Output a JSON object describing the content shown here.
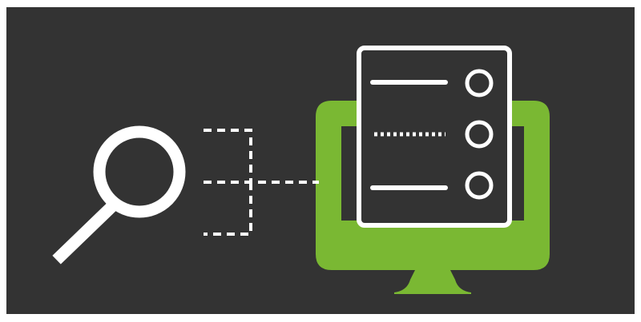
{
  "colors": {
    "page_background": "#ffffff",
    "panel_background": "#333333",
    "line_white": "#ffffff",
    "monitor_green": "#7ab833"
  },
  "icons": {
    "search": "magnifier-icon",
    "connector": "dashed-connector",
    "monitor": "desktop-monitor-icon",
    "document": "list-document-icon"
  },
  "document": {
    "rows": [
      {
        "line_style": "solid",
        "marker": "circle"
      },
      {
        "line_style": "dotted",
        "marker": "circle"
      },
      {
        "line_style": "solid",
        "marker": "circle"
      }
    ]
  }
}
